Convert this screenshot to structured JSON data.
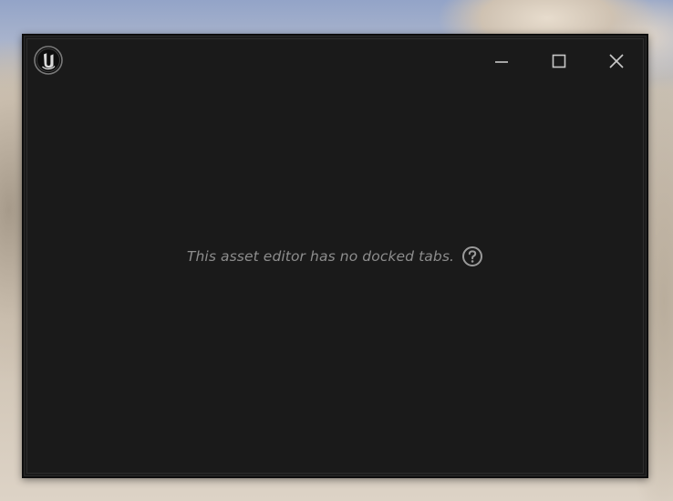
{
  "window": {
    "app_logo": "unreal-engine-logo-icon",
    "controls": {
      "minimize": "minimize-icon",
      "maximize": "maximize-icon",
      "close": "close-icon"
    }
  },
  "content": {
    "message": "This asset editor has no docked tabs.",
    "help_icon": "question-circle-icon"
  },
  "colors": {
    "window_bg": "#1a1a1a",
    "message_text": "#8d8d8d",
    "icon": "#c8c8c8"
  }
}
